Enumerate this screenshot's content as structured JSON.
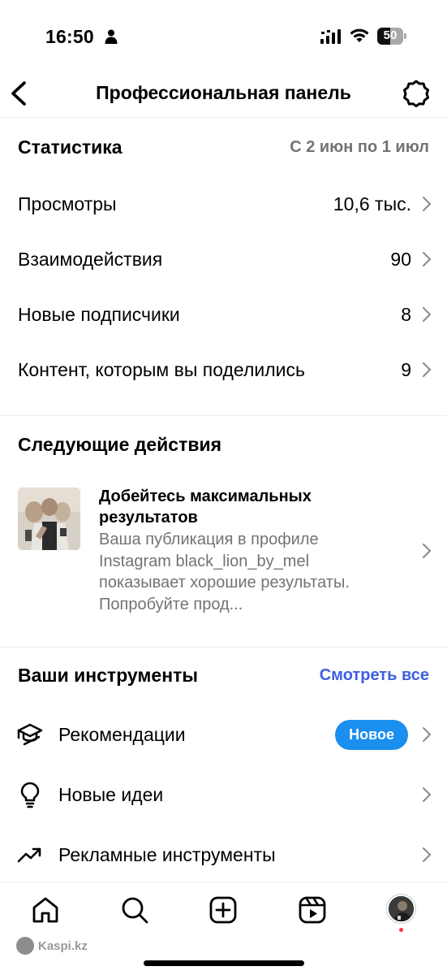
{
  "status_bar": {
    "time": "16:50",
    "battery_level": "50"
  },
  "header": {
    "title": "Профессиональная панель"
  },
  "statistics": {
    "title": "Статистика",
    "date_range": "С 2 июн по 1 июл",
    "rows": [
      {
        "label": "Просмотры",
        "value": "10,6 тыс."
      },
      {
        "label": "Взаимодействия",
        "value": "90"
      },
      {
        "label": "Новые подписчики",
        "value": "8"
      },
      {
        "label": "Контент, которым вы поделились",
        "value": "9"
      }
    ]
  },
  "next_actions": {
    "title": "Следующие действия",
    "card": {
      "title": "Добейтесь максимальных результатов",
      "description": "Ваша публикация в профиле Instagram black_lion_by_mel показывает хорошие результаты. Попробуйте прод..."
    }
  },
  "tools": {
    "title": "Ваши инструменты",
    "see_all": "Смотреть все",
    "items": [
      {
        "label": "Рекомендации",
        "badge": "Новое",
        "icon": "graduation-cap-icon"
      },
      {
        "label": "Новые идеи",
        "icon": "lightbulb-icon"
      },
      {
        "label": "Рекламные инструменты",
        "icon": "trend-up-icon"
      }
    ]
  },
  "tab_bar": {
    "icons": [
      "home-icon",
      "search-icon",
      "create-icon",
      "reels-icon",
      "profile-avatar"
    ]
  },
  "watermark": {
    "text": "Kaspi.kz"
  },
  "colors": {
    "accent_blue": "#3f5fe0",
    "badge_blue": "#1a8fef",
    "secondary_text": "#737373",
    "notification_red": "#ff3040"
  }
}
